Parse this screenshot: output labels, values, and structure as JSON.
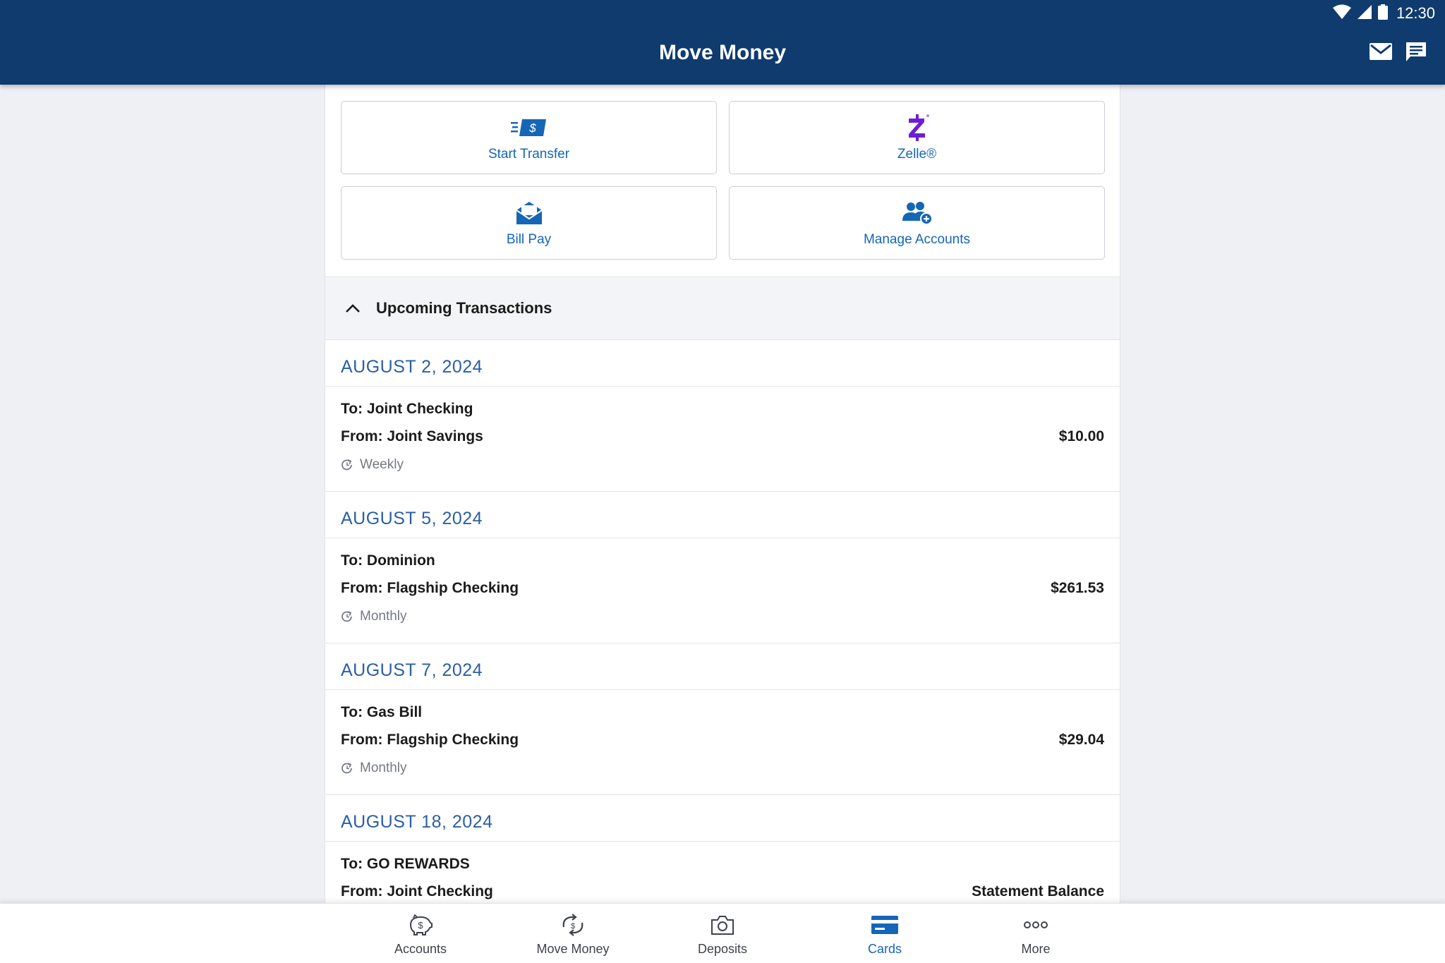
{
  "status": {
    "time": "12:30"
  },
  "header": {
    "title": "Move Money"
  },
  "actions": [
    {
      "label": "Start Transfer",
      "icon": "transfer-money-icon"
    },
    {
      "label": "Zelle®",
      "icon": "zelle-logo-icon"
    },
    {
      "label": "Bill Pay",
      "icon": "bill-envelope-icon"
    },
    {
      "label": "Manage Accounts",
      "icon": "manage-users-icon"
    }
  ],
  "upcoming": {
    "title": "Upcoming Transactions",
    "groups": [
      {
        "date": "AUGUST 2, 2024",
        "to": "To: Joint Checking",
        "from": "From: Joint Savings",
        "amount": "$10.00",
        "frequency": "Weekly"
      },
      {
        "date": "AUGUST 5, 2024",
        "to": "To: Dominion",
        "from": "From: Flagship Checking",
        "amount": "$261.53",
        "frequency": "Monthly"
      },
      {
        "date": "AUGUST 7, 2024",
        "to": "To: Gas Bill",
        "from": "From: Flagship Checking",
        "amount": "$29.04",
        "frequency": "Monthly"
      },
      {
        "date": "AUGUST 18, 2024",
        "to": "To: GO REWARDS",
        "from": "From: Joint Checking",
        "amount": "Statement Balance",
        "frequency": ""
      }
    ]
  },
  "nav": {
    "active": "Cards",
    "items": [
      {
        "label": "Accounts"
      },
      {
        "label": "Move Money"
      },
      {
        "label": "Deposits"
      },
      {
        "label": "Cards"
      },
      {
        "label": "More"
      }
    ]
  },
  "colors": {
    "header_bg": "#0f3b6e",
    "accent": "#1566b7",
    "date_blue": "#2a5fa6",
    "zelle_purple": "#6d1ed4"
  }
}
